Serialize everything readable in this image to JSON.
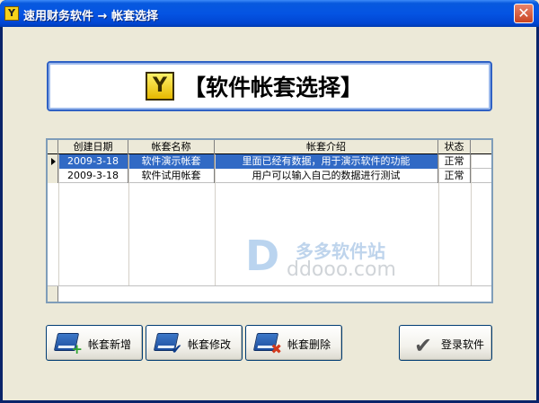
{
  "window": {
    "title": "速用财务软件 → 帐套选择",
    "app_icon": "Y",
    "close_glyph": "✕"
  },
  "banner": {
    "icon": "Y",
    "text": "【软件帐套选择】"
  },
  "grid": {
    "columns": [
      "创建日期",
      "帐套名称",
      "帐套介绍",
      "状态"
    ],
    "rows": [
      {
        "date": "2009-3-18",
        "name": "软件演示帐套",
        "intro": "里面已经有数据，用于演示软件的功能",
        "status": "正常"
      },
      {
        "date": "2009-3-18",
        "name": "软件试用帐套",
        "intro": "用户可以输入自己的数据进行测试",
        "status": "正常"
      }
    ],
    "selected_row": 0
  },
  "watermark": {
    "logo": "D",
    "cn": "多多软件站",
    "en": "ddooo.com"
  },
  "buttons": {
    "add": "帐套新增",
    "edit": "帐套修改",
    "delete": "帐套删除",
    "login": "登录软件"
  },
  "icons": {
    "add": "book-plus-icon",
    "edit": "book-check-icon",
    "delete": "book-delete-icon",
    "login": "checkmark-icon"
  }
}
